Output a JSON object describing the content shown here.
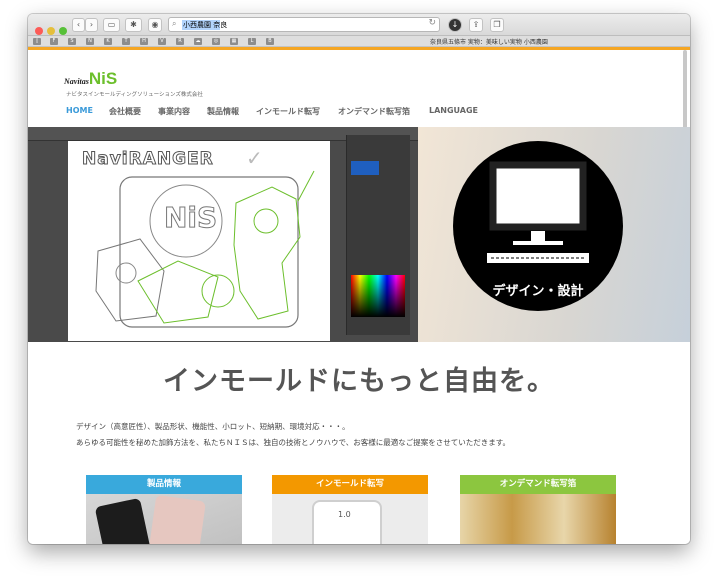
{
  "browser": {
    "url_text": "小西農園 奈良",
    "traffic_lights": {
      "close": "#fc5b57",
      "minimize": "#e5bf3c",
      "zoom": "#57c038"
    },
    "favorites_text": "奈良県五條市 実物：美味しい実物 小西農園",
    "favorites_icons": [
      "bookmarks-icon",
      "f-icon",
      "s-icon",
      "n-icon",
      "k-icon",
      "t-icon",
      "h-icon",
      "v-icon",
      "r-icon",
      "cloud-icon",
      "instagram-icon",
      "bbs-icon",
      "l-icon",
      "b-icon"
    ]
  },
  "site": {
    "brand": "Navitas",
    "brand_mark": "NiS",
    "company": "ナビタスインモールディングソリューションズ株式会社",
    "accent_color": "#f5a623",
    "nav": [
      "HOME",
      "会社概要",
      "事業内容",
      "製品情報",
      "インモールド転写",
      "オンデマンド転写箔",
      "LANGUAGE"
    ],
    "nav_active_color": "#3a9ad9",
    "hero": {
      "illustration_title": "NaviRANGER",
      "illustration_logo": "NiS",
      "circle_caption": "デザイン・設計"
    },
    "headline": "インモールドにもっと自由を。",
    "description": [
      "デザイン（高意匠性）、製品形状、機能性、小ロット、短納期、環境対応・・・。",
      "あらゆる可能性を秘めた加飾方法を、私たちＮＩＳは、独自の技術とノウハウで、お客様に最適なご提案をさせていただきます。"
    ],
    "cards": [
      {
        "label": "製品情報",
        "color": "#39a9dc"
      },
      {
        "label": "インモールド転写",
        "color": "#f39800"
      },
      {
        "label": "オンデマンド転写箔",
        "color": "#8cc63f"
      }
    ],
    "card_image_text": "1.0"
  }
}
